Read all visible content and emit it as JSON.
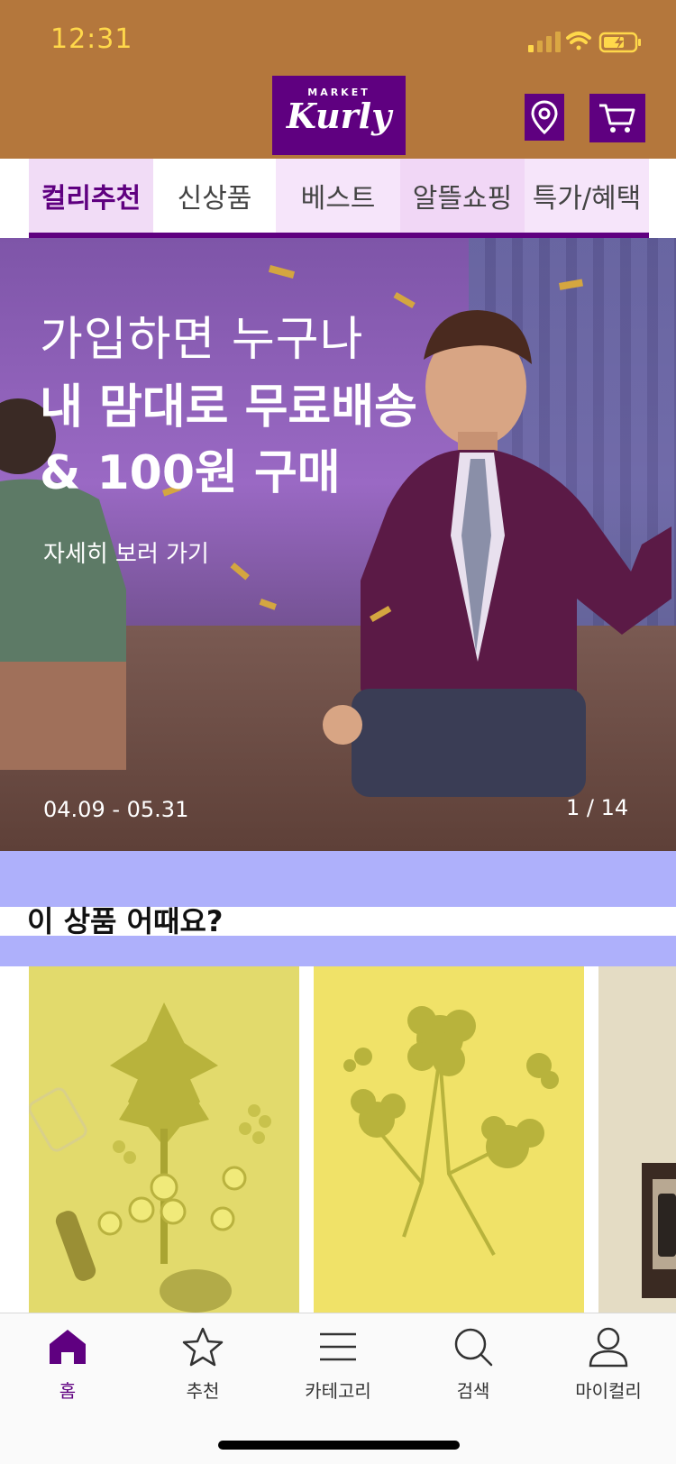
{
  "status_bar": {
    "time": "12:31"
  },
  "header": {
    "logo_market": "MARKET",
    "logo_kurly": "Kurly",
    "location_icon": "location-pin-icon",
    "cart_icon": "cart-icon"
  },
  "tabs": [
    {
      "label": "컬리추천",
      "active": true
    },
    {
      "label": "신상품",
      "active": false
    },
    {
      "label": "베스트",
      "active": false
    },
    {
      "label": "알뜰쇼핑",
      "active": false
    },
    {
      "label": "특가/혜택",
      "active": false
    }
  ],
  "hero": {
    "line1": "가입하면 누구나",
    "line2": "내 맘대로 무료배송",
    "line3": "& 100원 구매",
    "link": "자세히 보러 가기",
    "period": "04.09 - 05.31",
    "pager": "1 / 14"
  },
  "section": {
    "title": "이 상품 어때요?"
  },
  "bottom_nav": [
    {
      "label": "홈",
      "icon": "home-icon",
      "active": true
    },
    {
      "label": "추천",
      "icon": "star-icon",
      "active": false
    },
    {
      "label": "카테고리",
      "icon": "menu-icon",
      "active": false
    },
    {
      "label": "검색",
      "icon": "search-icon",
      "active": false
    },
    {
      "label": "마이컬리",
      "icon": "user-icon",
      "active": false
    }
  ],
  "colors": {
    "brand": "#5f0080",
    "header_bg": "#b4773c",
    "status_accent": "#ffd84a",
    "band": "#aeb0fb"
  }
}
